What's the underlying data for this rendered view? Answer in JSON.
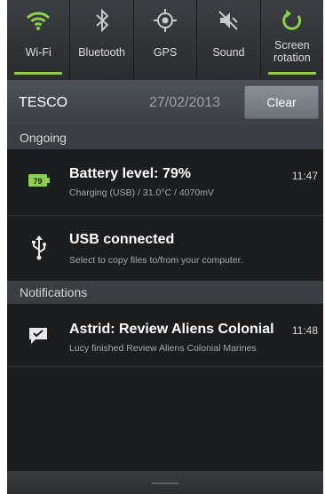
{
  "quick_settings": [
    {
      "label": "Wi-Fi",
      "icon": "wifi-icon",
      "on": true
    },
    {
      "label": "Bluetooth",
      "icon": "bluetooth-icon",
      "on": false
    },
    {
      "label": "GPS",
      "icon": "gps-icon",
      "on": false
    },
    {
      "label": "Sound",
      "icon": "sound-muted-icon",
      "on": false
    },
    {
      "label": "Screen rotation",
      "icon": "rotation-icon",
      "on": true
    }
  ],
  "carrier": {
    "name": "TESCO",
    "date": "27/02/2013",
    "clear_label": "Clear"
  },
  "ongoing": {
    "header": "Ongoing",
    "items": [
      {
        "title": "Battery level: 79%",
        "subtitle": "Charging (USB) / 31.0°C / 4070mV",
        "time": "11:47",
        "icon": "battery-icon",
        "badge": "79"
      },
      {
        "title": "USB connected",
        "subtitle": "Select to copy files to/from your computer.",
        "time": "",
        "icon": "usb-icon"
      }
    ]
  },
  "notifications": {
    "header": "Notifications",
    "items": [
      {
        "title": "Astrid: Review Aliens Colonial",
        "subtitle": "Lucy finished Review Aliens Colonial Marines",
        "time": "11:48",
        "icon": "message-icon"
      }
    ]
  },
  "colors": {
    "accent": "#8bd14a",
    "panel": "#1b1d1f"
  }
}
